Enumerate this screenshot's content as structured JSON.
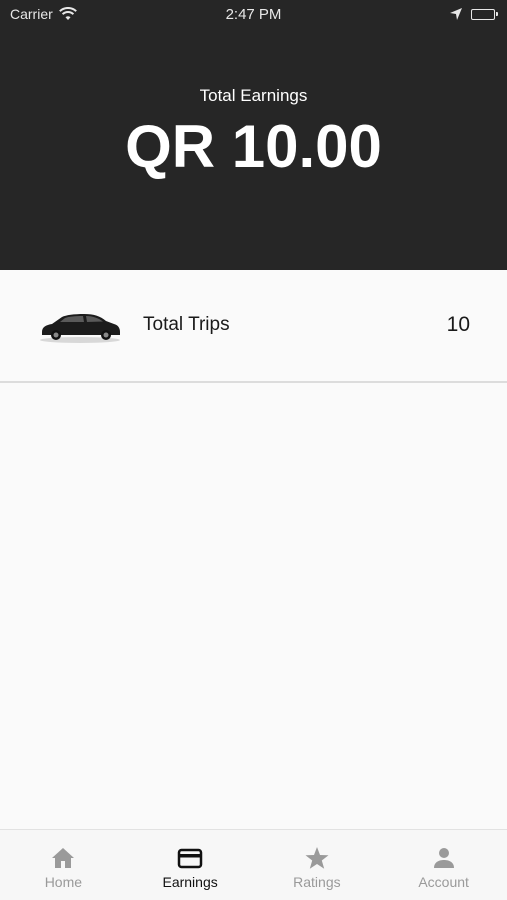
{
  "status_bar": {
    "carrier": "Carrier",
    "time": "2:47 PM"
  },
  "earnings": {
    "label": "Total Earnings",
    "value": "QR 10.00"
  },
  "trips": {
    "label": "Total Trips",
    "count": "10",
    "icon": "car-icon"
  },
  "tabs": [
    {
      "label": "Home",
      "icon": "home-icon",
      "active": false
    },
    {
      "label": "Earnings",
      "icon": "card-icon",
      "active": true
    },
    {
      "label": "Ratings",
      "icon": "star-icon",
      "active": false
    },
    {
      "label": "Account",
      "icon": "person-icon",
      "active": false
    }
  ],
  "colors": {
    "header_bg": "#262626",
    "page_bg": "#fafafa",
    "tab_active": "#111111",
    "tab_inactive": "#9a9a9a"
  }
}
